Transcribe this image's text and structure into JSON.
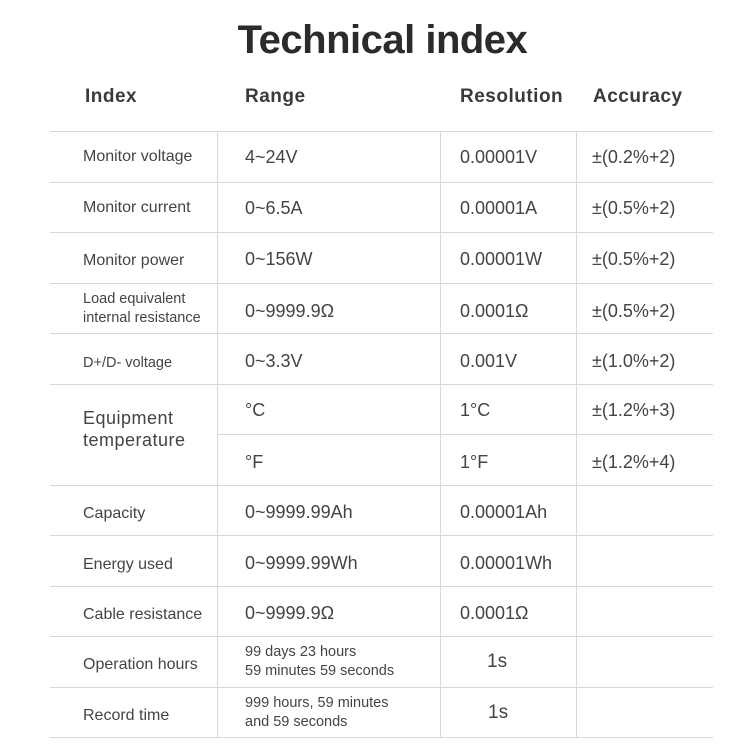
{
  "title": "Technical index",
  "headers": {
    "index": "Index",
    "range": "Range",
    "resolution": "Resolution",
    "accuracy": "Accuracy"
  },
  "rows": [
    {
      "index": "Monitor voltage",
      "range": "4~24V",
      "resolution": "0.00001V",
      "accuracy": "±(0.2%+2)"
    },
    {
      "index": "Monitor current",
      "range": "0~6.5A",
      "resolution": "0.00001A",
      "accuracy": "±(0.5%+2)"
    },
    {
      "index": "Monitor power",
      "range": "0~156W",
      "resolution": "0.00001W",
      "accuracy": "±(0.5%+2)"
    },
    {
      "index_line1": "Load equivalent",
      "index_line2": "internal resistance",
      "range": "0~9999.9Ω",
      "resolution": "0.0001Ω",
      "accuracy": "±(0.5%+2)"
    },
    {
      "index": "D+/D- voltage",
      "range": "0~3.3V",
      "resolution": "0.001V",
      "accuracy": "±(1.0%+2)"
    },
    {
      "index_line1": "Equipment",
      "index_line2": "temperature",
      "sub": [
        {
          "range": "°C",
          "resolution": "1°C",
          "accuracy": "±(1.2%+3)"
        },
        {
          "range": "°F",
          "resolution": "1°F",
          "accuracy": "±(1.2%+4)"
        }
      ]
    },
    {
      "index": "Capacity",
      "range": "0~9999.99Ah",
      "resolution": "0.00001Ah",
      "accuracy": ""
    },
    {
      "index": "Energy used",
      "range": "0~9999.99Wh",
      "resolution": "0.00001Wh",
      "accuracy": ""
    },
    {
      "index": "Cable resistance",
      "range": "0~9999.9Ω",
      "resolution": "0.0001Ω",
      "accuracy": ""
    },
    {
      "index": "Operation hours",
      "range_line1": "99 days 23 hours",
      "range_line2": "59 minutes 59 seconds",
      "resolution": "1s",
      "accuracy": ""
    },
    {
      "index": "Record time",
      "range_line1": "999 hours, 59 minutes",
      "range_line2": "and 59 seconds",
      "resolution": "1s",
      "accuracy": ""
    }
  ]
}
